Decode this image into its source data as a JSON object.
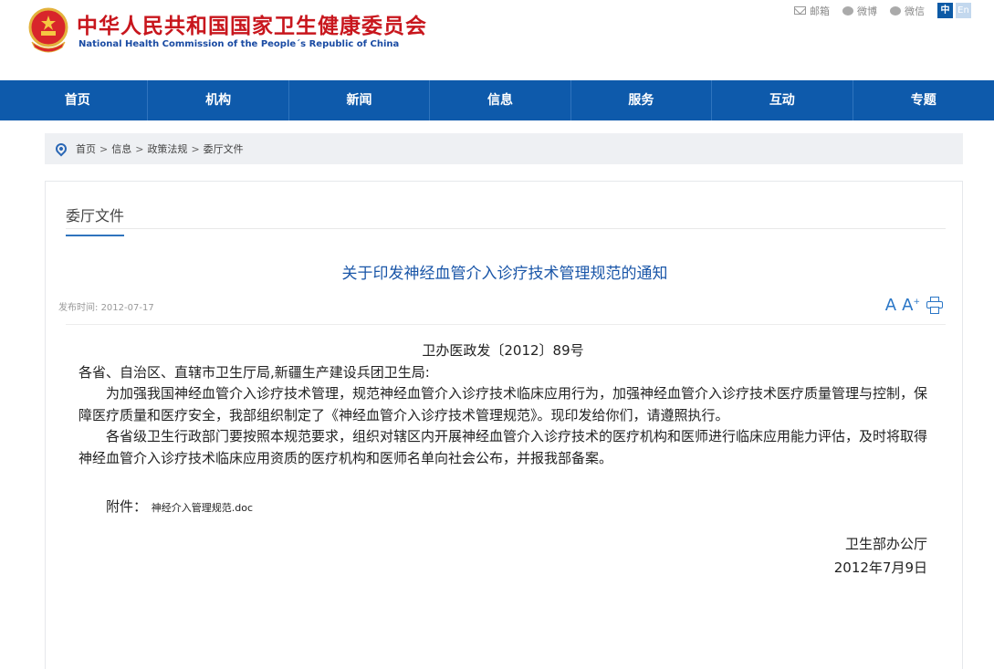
{
  "header": {
    "site_name_cn": "中华人民共和国国家卫生健康委员会",
    "site_name_en": "National Health Commission of the People´s Republic of China",
    "links": {
      "mail": "邮箱",
      "weibo": "微博",
      "wechat": "微信"
    },
    "lang_zh": "中",
    "lang_en": "En"
  },
  "nav": {
    "items": [
      "首页",
      "机构",
      "新闻",
      "信息",
      "服务",
      "互动",
      "专题"
    ]
  },
  "breadcrumb": {
    "items": [
      "首页",
      "信息",
      "政策法规",
      "委厅文件"
    ],
    "separator": ">"
  },
  "section": {
    "title": "委厅文件"
  },
  "article": {
    "title": "关于印发神经血管介入诊疗技术管理规范的通知",
    "publish_label": "发布时间:",
    "publish_date": "2012-07-17",
    "font_small": "A",
    "font_large": "A",
    "font_large_sup": "+",
    "doc_number": "卫办医政发〔2012〕89号",
    "addressee": "各省、自治区、直辖市卫生厅局,新疆生产建设兵团卫生局:",
    "paragraph_1": "为加强我国神经血管介入诊疗技术管理，规范神经血管介入诊疗技术临床应用行为，加强神经血管介入诊疗技术医疗质量管理与控制，保障医疗质量和医疗安全，我部组织制定了《神经血管介入诊疗技术管理规范》。现印发给你们，请遵照执行。",
    "paragraph_2": "各省级卫生行政部门要按照本规范要求，组织对辖区内开展神经血管介入诊疗技术的医疗机构和医师进行临床应用能力评估，及时将取得神经血管介入诊疗技术临床应用资质的医疗机构和医师名单向社会公布，并报我部备案。",
    "attachment_label": "附件：",
    "attachment_file": "神经介入管理规范.doc",
    "signer": "卫生部办公厅",
    "sign_date": "2012年7月9日"
  },
  "colors": {
    "brand_red": "#c8161d",
    "nav_blue": "#0e5aab",
    "title_blue": "#1a56a8"
  }
}
